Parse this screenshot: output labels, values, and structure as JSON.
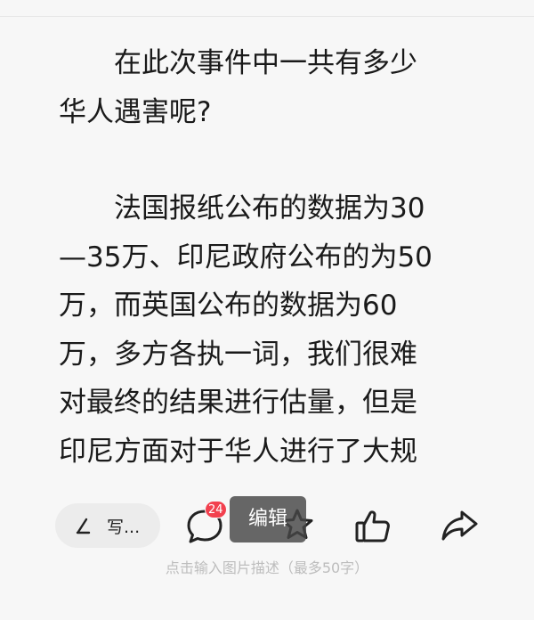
{
  "article": {
    "paragraphs": [
      {
        "lines": [
          "在此次事件中一共有多少",
          "华人遇害呢?"
        ]
      },
      {
        "lines": [
          "法国报纸公布的数据为30",
          "—35万、印尼政府公布的为50",
          "万，而英国公布的数据为60",
          "万，多方各执一词，我们很难",
          "对最终的结果进行估量，但是",
          "印尼方面对于华人进行了大规"
        ]
      }
    ]
  },
  "action_bar": {
    "write_label": "写...",
    "comment_count": "24",
    "edit_label": "编辑",
    "icons": {
      "write": "pencil-icon",
      "comment": "comment-bubble-icon",
      "favorite": "star-icon",
      "like": "thumbs-up-icon",
      "share": "share-arrow-icon"
    }
  },
  "caption": {
    "placeholder": "点击输入图片描述（最多50字）"
  }
}
